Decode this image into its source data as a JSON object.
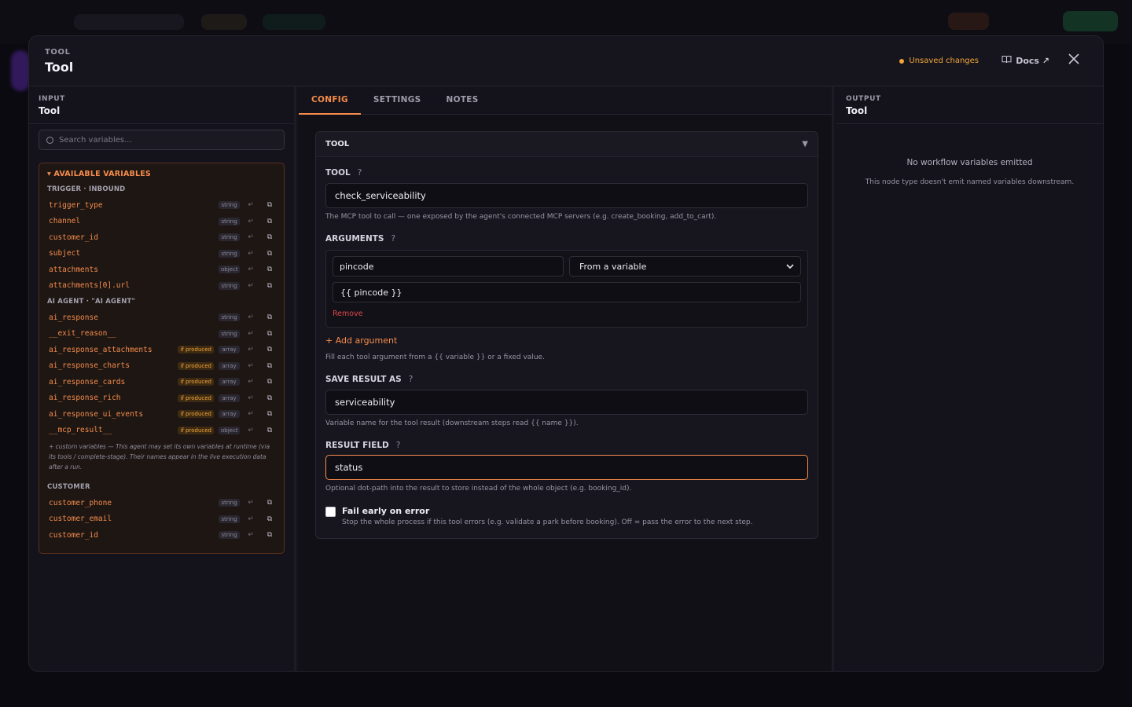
{
  "header": {
    "eyebrow": "TOOL",
    "title": "Tool",
    "unsaved": "Unsaved changes",
    "docs": "Docs ↗"
  },
  "input_panel": {
    "eyebrow": "INPUT",
    "title": "Tool",
    "search_placeholder": "Search variables...",
    "vars_title": "▾ AVAILABLE VARIABLES",
    "groups": {
      "trigger": "TRIGGER · INBOUND",
      "agent": "AI AGENT · \"AI AGENT\"",
      "customer": "CUSTOMER"
    },
    "trigger_vars": [
      {
        "name": "trigger_type",
        "type": "string"
      },
      {
        "name": "channel",
        "type": "string"
      },
      {
        "name": "customer_id",
        "type": "string"
      },
      {
        "name": "subject",
        "type": "string"
      },
      {
        "name": "attachments",
        "type": "object"
      },
      {
        "name": "attachments[0].url",
        "type": "string"
      }
    ],
    "agent_vars": [
      {
        "name": "ai_response",
        "type": "string",
        "produced": ""
      },
      {
        "name": "__exit_reason__",
        "type": "string",
        "produced": ""
      },
      {
        "name": "ai_response_attachments",
        "type": "array",
        "produced": "if produced"
      },
      {
        "name": "ai_response_charts",
        "type": "array",
        "produced": "if produced"
      },
      {
        "name": "ai_response_cards",
        "type": "array",
        "produced": "if produced"
      },
      {
        "name": "ai_response_rich",
        "type": "array",
        "produced": "if produced"
      },
      {
        "name": "ai_response_ui_events",
        "type": "array",
        "produced": "if produced"
      },
      {
        "name": "__mcp_result__",
        "type": "object",
        "produced": "if produced"
      }
    ],
    "agent_note": "+ custom variables — This agent may set its own variables at runtime (via its tools / complete-stage). Their names appear in the live execution data after a run.",
    "customer_vars": [
      {
        "name": "customer_phone",
        "type": "string"
      },
      {
        "name": "customer_email",
        "type": "string"
      },
      {
        "name": "customer_id",
        "type": "string"
      }
    ]
  },
  "tabs": [
    "CONFIG",
    "SETTINGS",
    "NOTES"
  ],
  "config": {
    "card_title": "TOOL",
    "tool_label": "TOOL",
    "tool_value": "check_serviceability",
    "tool_help": "The MCP tool to call — one exposed by the agent's connected MCP servers (e.g. create_booking, add_to_cart).",
    "arguments_label": "ARGUMENTS",
    "arg_name": "pincode",
    "arg_source": "From a variable",
    "arg_value": "{{ pincode }}",
    "remove": "Remove",
    "add_argument": "+ Add argument",
    "arguments_help": "Fill each tool argument from a {{ variable }} or a fixed value.",
    "save_label": "SAVE RESULT AS",
    "save_value": "serviceability",
    "save_help": "Variable name for the tool result (downstream steps read {{ name }}).",
    "result_label": "RESULT FIELD",
    "result_value": "status",
    "result_help": "Optional dot-path into the result to store instead of the whole object (e.g. booking_id).",
    "fail_title": "Fail early on error",
    "fail_desc": "Stop the whole process if this tool errors (e.g. validate a park before booking). Off = pass the error to the next step.",
    "fail_checked": false
  },
  "output_panel": {
    "eyebrow": "OUTPUT",
    "title": "Tool",
    "empty_title": "No workflow variables emitted",
    "empty_desc": "This node type doesn't emit named variables downstream."
  },
  "colors": {
    "accent": "#f58c4b",
    "warning": "#f0a53a",
    "danger": "#e0484b"
  }
}
